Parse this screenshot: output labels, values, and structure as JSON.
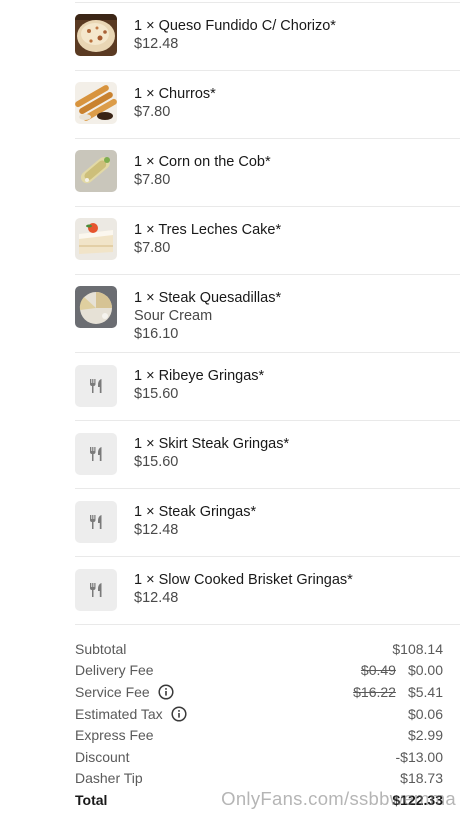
{
  "items": [
    {
      "name": "1 × Queso Fundido C/ Chorizo*",
      "price": "$12.48",
      "image": "queso-fundido-photo"
    },
    {
      "name": "1 × Churros*",
      "price": "$7.80",
      "image": "churros-photo"
    },
    {
      "name": "1 × Corn on the Cob*",
      "price": "$7.80",
      "image": "corn-photo"
    },
    {
      "name": "1 × Tres Leches Cake*",
      "price": "$7.80",
      "image": "tres-leches-photo"
    },
    {
      "name": "1 × Steak Quesadillas*",
      "option": "Sour Cream",
      "price": "$16.10",
      "image": "quesadilla-photo"
    },
    {
      "name": "1 × Ribeye Gringas*",
      "price": "$15.60",
      "image": "utensils-icon"
    },
    {
      "name": "1 × Skirt Steak Gringas*",
      "price": "$15.60",
      "image": "utensils-icon"
    },
    {
      "name": "1 × Steak Gringas*",
      "price": "$12.48",
      "image": "utensils-icon"
    },
    {
      "name": "1 × Slow Cooked Brisket Gringas*",
      "price": "$12.48",
      "image": "utensils-icon"
    }
  ],
  "summary": {
    "subtotal": {
      "label": "Subtotal",
      "value": "$108.14"
    },
    "delivery_fee": {
      "label": "Delivery Fee",
      "original": "$0.49",
      "value": "$0.00"
    },
    "service_fee": {
      "label": "Service Fee",
      "original": "$16.22",
      "value": "$5.41",
      "icon": "info-icon"
    },
    "estimated_tax": {
      "label": "Estimated Tax",
      "value": "$0.06",
      "icon": "info-icon"
    },
    "express_fee": {
      "label": "Express Fee",
      "value": "$2.99"
    },
    "discount": {
      "label": "Discount",
      "value": "-$13.00"
    },
    "dasher_tip": {
      "label": "Dasher Tip",
      "value": "$18.73"
    },
    "total": {
      "label": "Total",
      "value": "$122.33"
    }
  },
  "watermark": "OnlyFans.com/ssbbwemma",
  "colors": {
    "text": "#191919",
    "secondary": "#494949",
    "divider": "#e9e9e9",
    "placeholder_bg": "#ededed"
  }
}
